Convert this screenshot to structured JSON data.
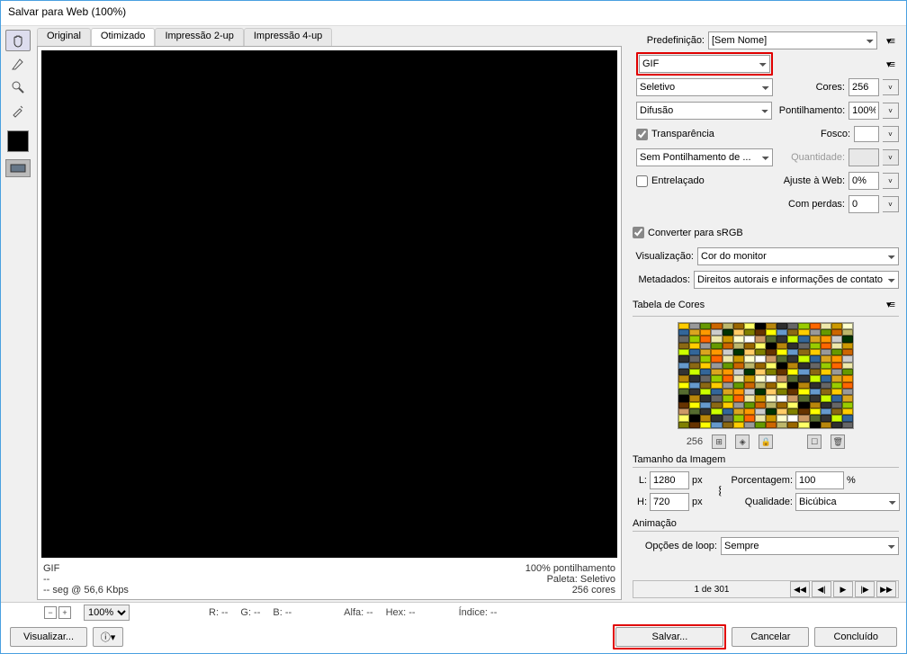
{
  "title": "Salvar para Web (100%)",
  "tabs": [
    "Original",
    "Otimizado",
    "Impressão 2-up",
    "Impressão 4-up"
  ],
  "preview_info_left": [
    "GIF",
    "--",
    "-- seg @ 56,6 Kbps"
  ],
  "preview_info_right": [
    "100% pontilhamento",
    "Paleta: Seletivo",
    "256 cores"
  ],
  "labels": {
    "preset": "Predefinição:",
    "preset_val": "[Sem Nome]",
    "format": "GIF",
    "reduction": "Seletivo",
    "colors": "Cores:",
    "colors_val": "256",
    "dither": "Difusão",
    "dither_lbl": "Pontilhamento:",
    "dither_val": "100%",
    "transp": "Transparência",
    "matte": "Fosco:",
    "matte_dither": "Sem Pontilhamento de ...",
    "qty": "Quantidade:",
    "interlace": "Entrelaçado",
    "websnap": "Ajuste à Web:",
    "websnap_val": "0%",
    "lossy": "Com perdas:",
    "lossy_val": "0",
    "srgb": "Converter para sRGB",
    "vis": "Visualização:",
    "vis_val": "Cor do monitor",
    "meta": "Metadados:",
    "meta_val": "Direitos autorais e informações de contato",
    "ct_title": "Tabela de Cores",
    "ct_count": "256",
    "isize": "Tamanho da Imagem",
    "w": "L:",
    "w_val": "1280",
    "h": "H:",
    "h_val": "720",
    "px": "px",
    "pct": "Porcentagem:",
    "pct_val": "100",
    "pct_sym": "%",
    "quality": "Qualidade:",
    "quality_val": "Bicúbica",
    "anim": "Animação",
    "loop": "Opções de loop:",
    "loop_val": "Sempre",
    "frames": "1 de 301"
  },
  "status": {
    "zoom": "100%",
    "r": "R: --",
    "g": "G: --",
    "b": "B: --",
    "alpha": "Alfa: --",
    "hex": "Hex: --",
    "index": "Índice: --"
  },
  "buttons": {
    "preview": "Visualizar...",
    "save": "Salvar...",
    "cancel": "Cancelar",
    "done": "Concluído"
  }
}
